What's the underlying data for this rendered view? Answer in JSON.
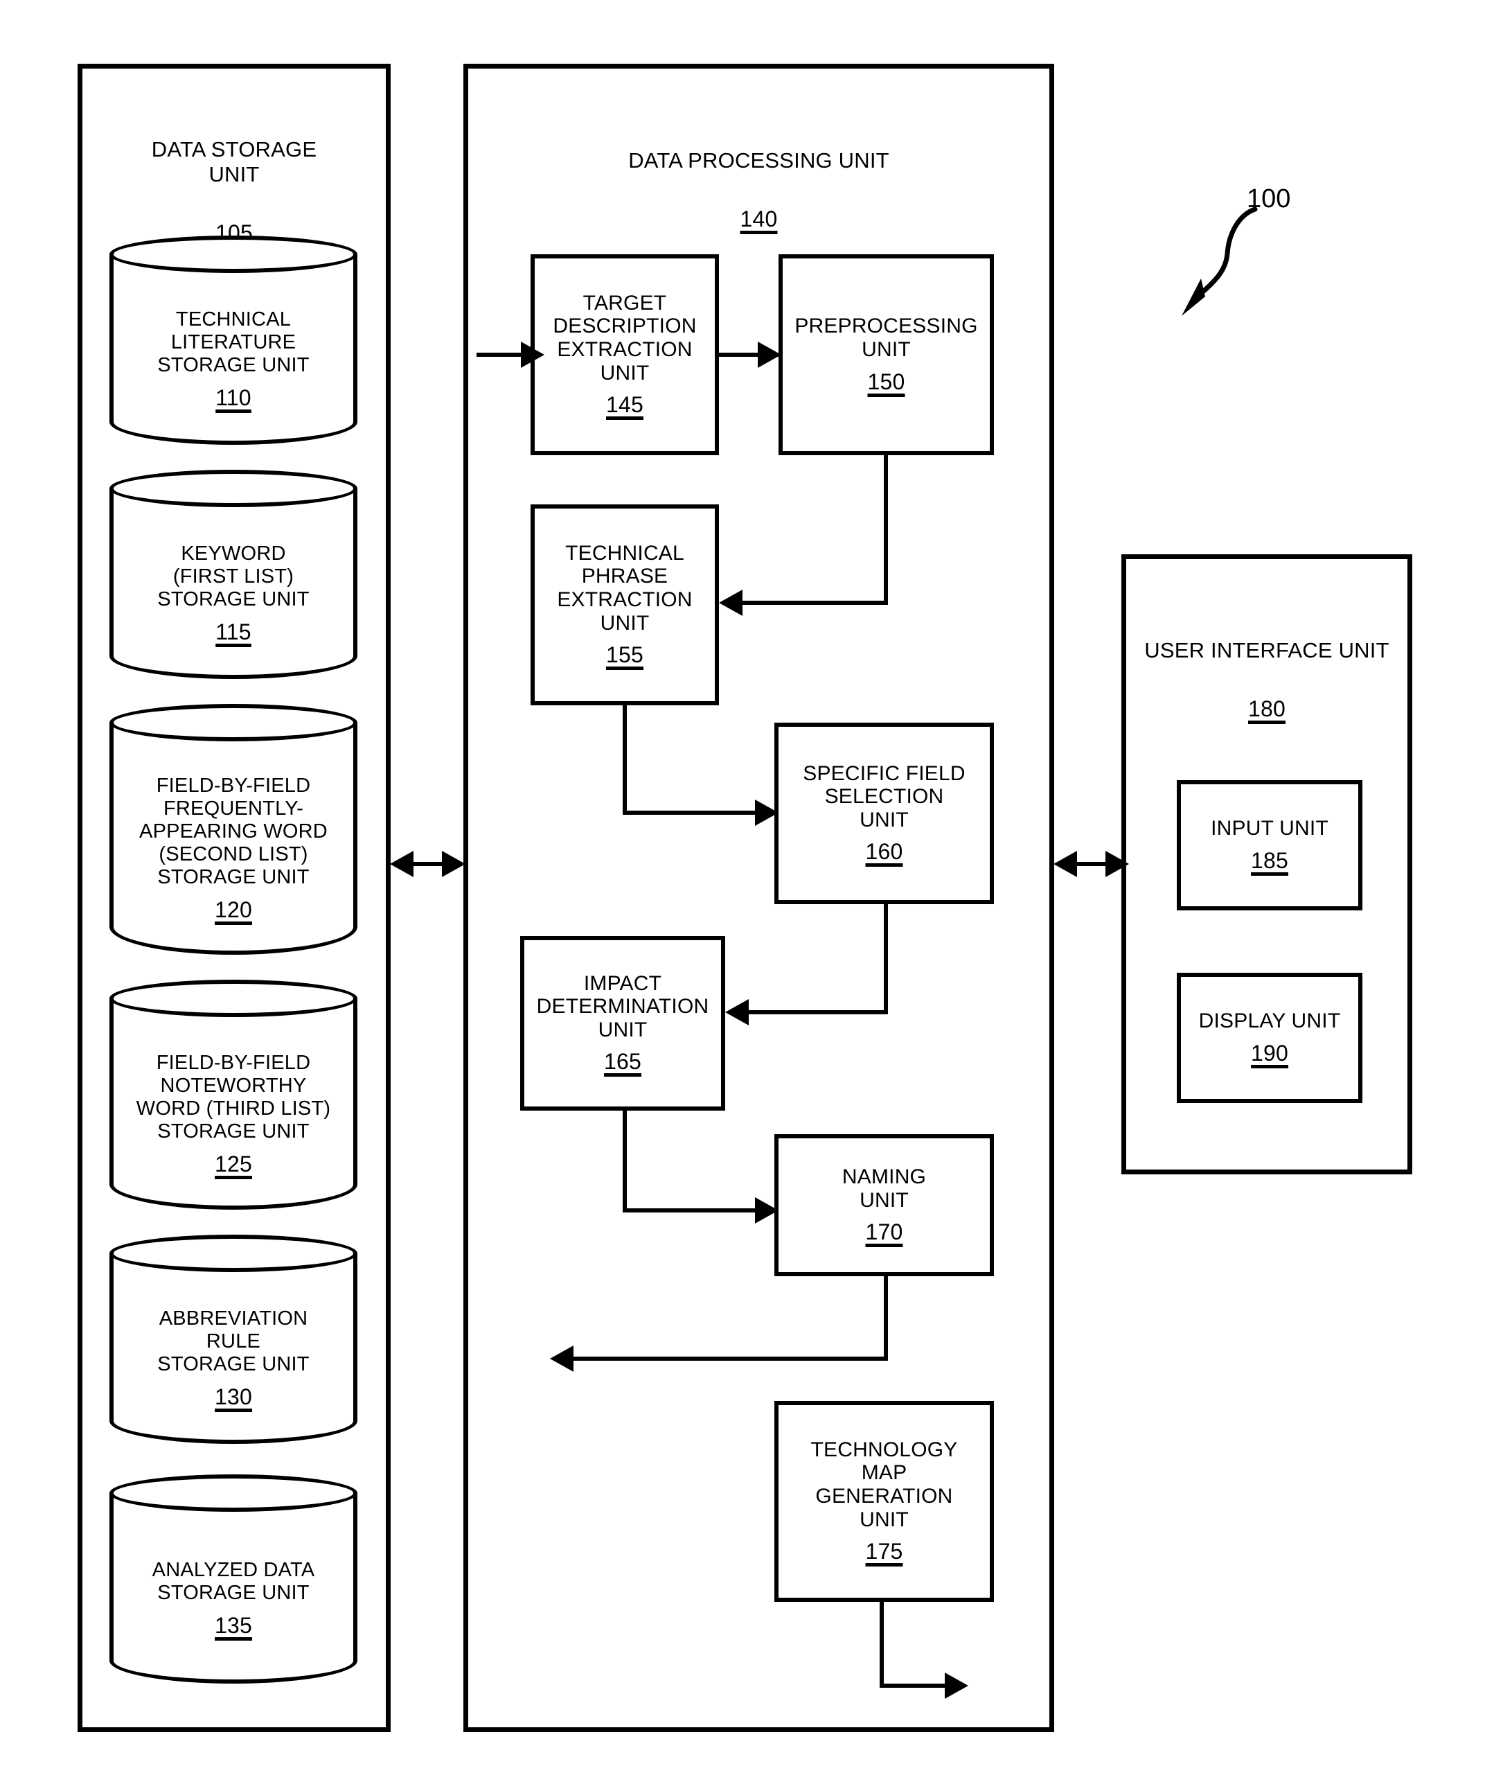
{
  "figure": {
    "callout_label": "100"
  },
  "data_storage_unit": {
    "title": "DATA STORAGE\nUNIT",
    "ref": "105",
    "stores": [
      {
        "label": "TECHNICAL\nLITERATURE\nSTORAGE UNIT",
        "ref": "110"
      },
      {
        "label": "KEYWORD\n(FIRST LIST)\nSTORAGE UNIT",
        "ref": "115"
      },
      {
        "label": "FIELD-BY-FIELD\nFREQUENTLY-\nAPPEARING WORD\n(SECOND LIST)\nSTORAGE UNIT",
        "ref": "120"
      },
      {
        "label": "FIELD-BY-FIELD\nNOTEWORTHY\nWORD (THIRD LIST)\nSTORAGE UNIT",
        "ref": "125"
      },
      {
        "label": "ABBREVIATION\nRULE\nSTORAGE UNIT",
        "ref": "130"
      },
      {
        "label": "ANALYZED DATA\nSTORAGE UNIT",
        "ref": "135"
      }
    ]
  },
  "data_processing_unit": {
    "title": "DATA PROCESSING UNIT",
    "ref": "140",
    "units": [
      {
        "label": "TARGET\nDESCRIPTION\nEXTRACTION\nUNIT",
        "ref": "145"
      },
      {
        "label": "PREPROCESSING\nUNIT",
        "ref": "150"
      },
      {
        "label": "TECHNICAL\nPHRASE\nEXTRACTION\nUNIT",
        "ref": "155"
      },
      {
        "label": "SPECIFIC FIELD\nSELECTION\nUNIT",
        "ref": "160"
      },
      {
        "label": "IMPACT\nDETERMINATION\nUNIT",
        "ref": "165"
      },
      {
        "label": "NAMING\nUNIT",
        "ref": "170"
      },
      {
        "label": "TECHNOLOGY\nMAP\nGENERATION\nUNIT",
        "ref": "175"
      }
    ]
  },
  "user_interface_unit": {
    "title": "USER INTERFACE UNIT",
    "ref": "180",
    "units": [
      {
        "label": "INPUT UNIT",
        "ref": "185"
      },
      {
        "label": "DISPLAY UNIT",
        "ref": "190"
      }
    ]
  }
}
